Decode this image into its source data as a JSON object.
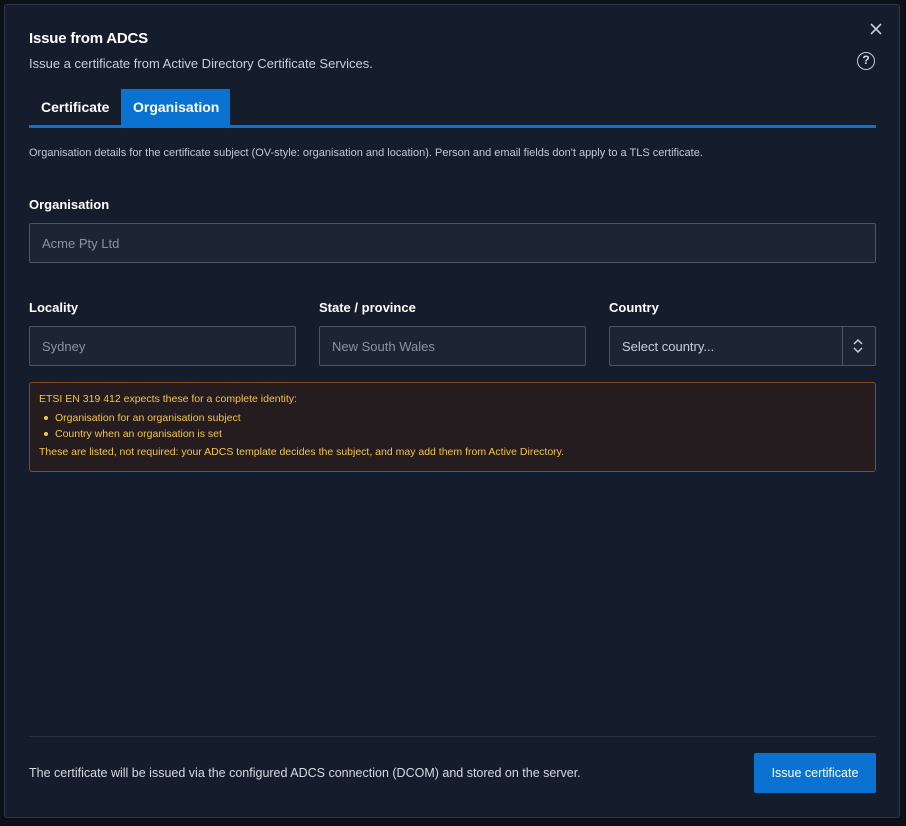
{
  "dialog": {
    "title": "Issue from ADCS",
    "subtitle": "Issue a certificate from Active Directory Certificate Services.",
    "close_icon": "close-icon",
    "help_icon": "question-circle-icon",
    "help_glyph": "?"
  },
  "tabs": [
    {
      "label": "Certificate",
      "active": false
    },
    {
      "label": "Organisation",
      "active": true
    }
  ],
  "note": "Organisation details for the certificate subject (OV-style: organisation and location). Person and email fields don't apply to a TLS certificate.",
  "fields": {
    "organisation": {
      "label": "Organisation",
      "value": "",
      "placeholder": "Acme Pty Ltd"
    },
    "locality": {
      "label": "Locality",
      "value": "",
      "placeholder": "Sydney"
    },
    "state": {
      "label": "State / province",
      "value": "",
      "placeholder": "New South Wales"
    },
    "country": {
      "label": "Country",
      "selected": "Select country...",
      "icon": "chevron-up-down-icon"
    }
  },
  "warning": {
    "heading": "ETSI EN 319 412 expects these for a complete identity:",
    "items": [
      "Organisation for an organisation subject",
      "Country when an organisation is set"
    ],
    "footer": "These are listed, not required: your ADCS template decides the subject, and may add them from Active Directory.",
    "color": "#f3c44a"
  },
  "footer": {
    "text": "The certificate will be issued via the configured ADCS connection (DCOM) and stored on the server.",
    "button_label": "Issue certificate"
  },
  "colors": {
    "accent": "#0a73d1",
    "background": "#151c2b",
    "warning_border": "#8a4a1e"
  }
}
